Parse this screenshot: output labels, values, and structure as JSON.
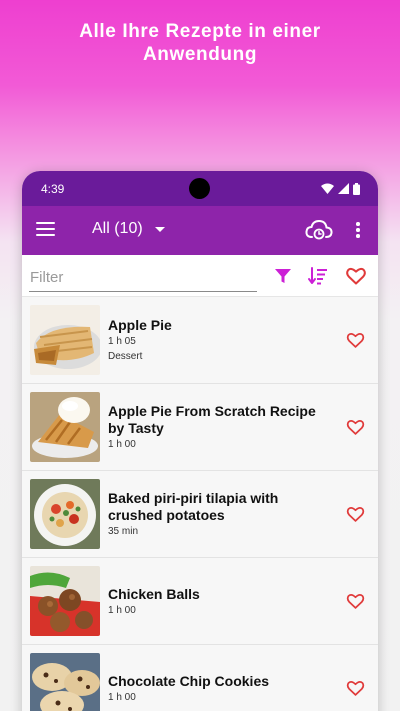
{
  "promo": {
    "line1": "Alle Ihre Rezepte in einer",
    "line2": "Anwendung"
  },
  "status_bar": {
    "time": "4:39"
  },
  "app_bar": {
    "category_label": "All (10)"
  },
  "filter": {
    "placeholder": "Filter"
  },
  "colors": {
    "accent": "#cc20d6",
    "favorite": "#e03a3a",
    "appbar": "#8e24aa",
    "statusbar": "#6a1b9a"
  },
  "recipes": [
    {
      "title": "Apple Pie",
      "time": "1 h 05",
      "category": "Dessert",
      "image": "apple-pie"
    },
    {
      "title": "Apple Pie From Scratch Recipe by Tasty",
      "time": "1 h 00",
      "category": "",
      "image": "apple-pie-ice-cream"
    },
    {
      "title": "Baked piri-piri tilapia with crushed potatoes",
      "time": "35 min",
      "category": "",
      "image": "tilapia-plate"
    },
    {
      "title": "Chicken Balls",
      "time": "1 h 00",
      "category": "",
      "image": "chicken-balls"
    },
    {
      "title": "Chocolate Chip Cookies",
      "time": "1 h 00",
      "category": "",
      "image": "cookies"
    }
  ]
}
